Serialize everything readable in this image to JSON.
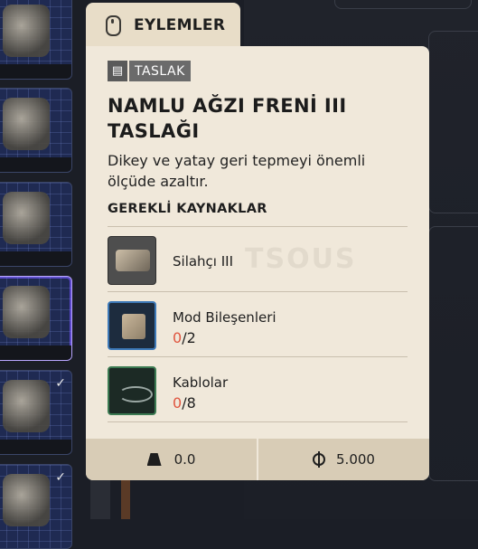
{
  "tab": {
    "label": "EYLEMLER",
    "icon": "mouse-icon"
  },
  "card": {
    "badge_icon": "book-icon",
    "badge_label": "TASLAK",
    "title": "NAMLU AĞZI FRENİ III TASLAĞI",
    "description": "Dikey ve yatay geri tepmeyi önemli ölçüde azaltır.",
    "requirements_heading": "GEREKLİ KAYNAKLAR",
    "watermark": "TSOUS",
    "resources": [
      {
        "name": "Silahçı III",
        "have": null,
        "need": null
      },
      {
        "name": "Mod Bileşenleri",
        "have": "0",
        "need": "/2"
      },
      {
        "name": "Kablolar",
        "have": "0",
        "need": "/8"
      }
    ],
    "footer": {
      "weight_icon": "weight-icon",
      "weight": "0.0",
      "price_icon": "coin-icon",
      "price": "5.000"
    }
  },
  "colors": {
    "card_bg": "#f0e8da",
    "tab_bg": "#e8ddc8",
    "footer_bg": "#d8ccb6",
    "missing_count": "#e0553f",
    "inventory_slot": "#1f2a52"
  }
}
